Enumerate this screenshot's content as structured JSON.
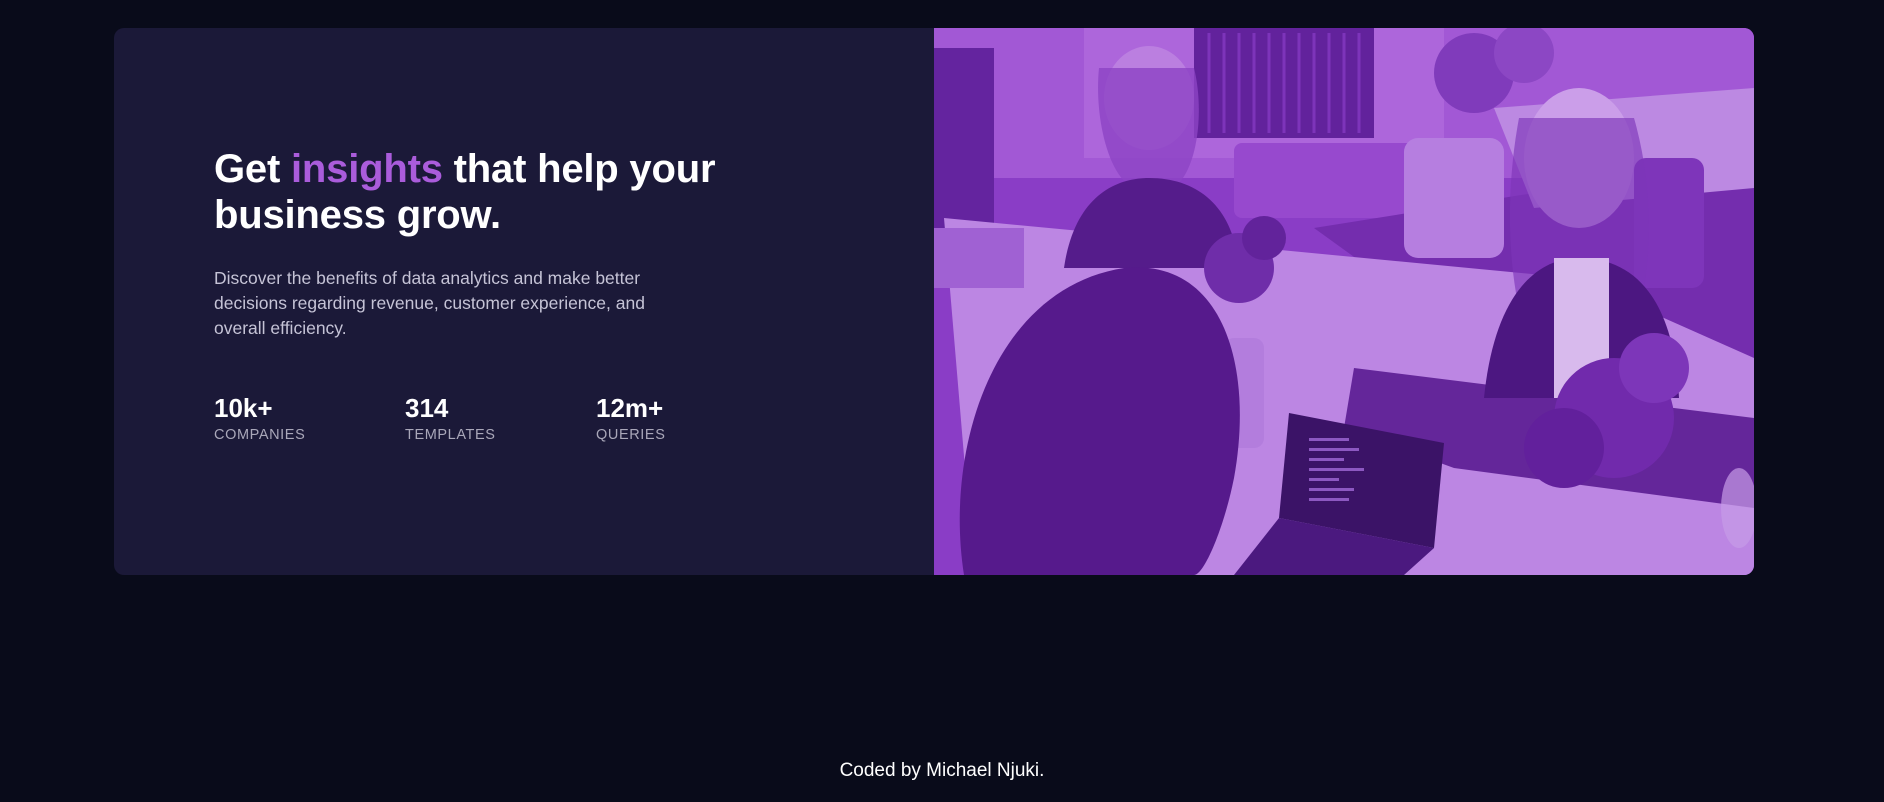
{
  "hero": {
    "headline_start": "Get ",
    "headline_accent": "insights",
    "headline_end": " that help your business grow.",
    "description": "Discover the benefits of data analytics and make better decisions regarding revenue, customer experience, and overall efficiency.",
    "stats": [
      {
        "value": "10k+",
        "label": "Companies"
      },
      {
        "value": "314",
        "label": "Templates"
      },
      {
        "value": "12m+",
        "label": "Queries"
      }
    ]
  },
  "footer": {
    "credit": "Coded by Michael Njuki."
  },
  "colors": {
    "page_background": "#090b1a",
    "card_background": "#1b1938",
    "accent": "#aa5cdb",
    "image_overlay": "#8d3cc8"
  }
}
